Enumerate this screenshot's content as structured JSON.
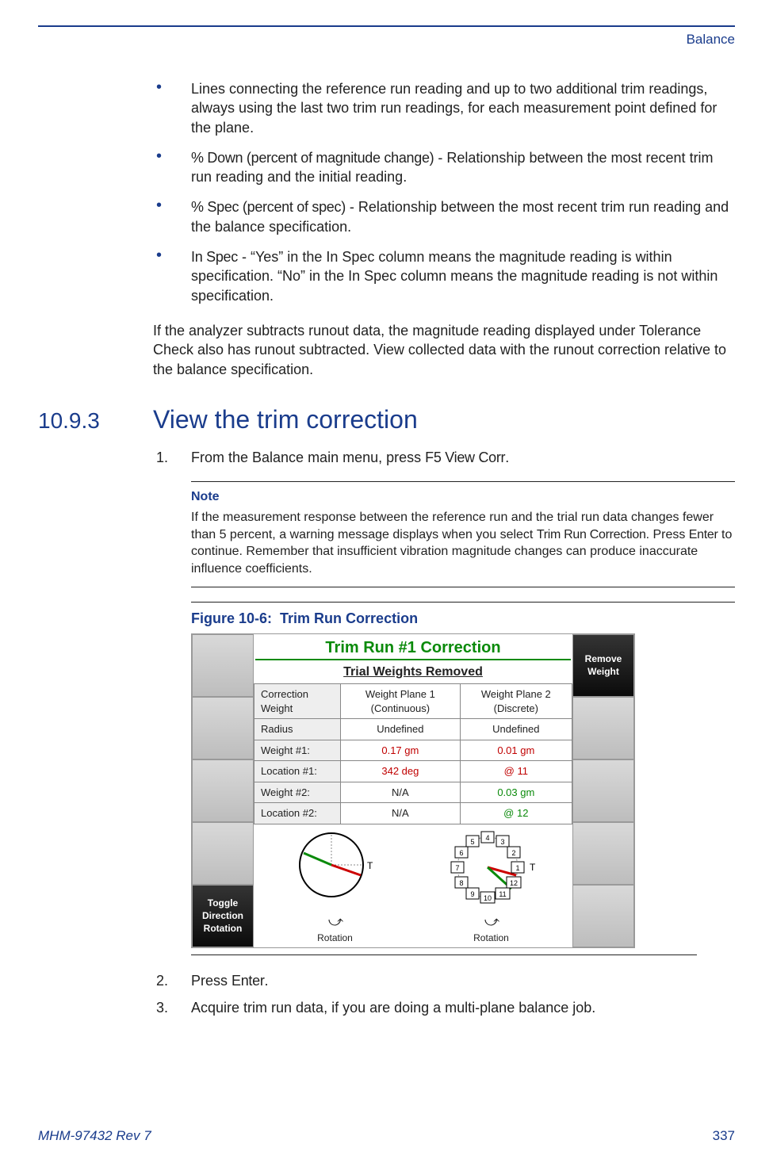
{
  "header": {
    "section": "Balance"
  },
  "bullets": [
    {
      "text": "Lines connecting the reference run reading and up to two additional trim readings, always using the last two trim run readings, for each measurement point defined for the plane."
    },
    {
      "lead": "% Down (percent of magnitude change)",
      "text": " - Relationship between the most recent trim run reading and the initial reading."
    },
    {
      "lead": "% Spec (percent of spec)",
      "text": " - Relationship between the most recent trim run reading and the balance specification."
    },
    {
      "lead": "In Spec",
      "text": " - “Yes” in the In Spec column means the magnitude reading is within specification. “No” in the In Spec column means the magnitude reading is not within specification."
    }
  ],
  "para_after_bullets": "If the analyzer subtracts runout data, the magnitude reading displayed under Tolerance Check also has runout subtracted. View collected data with the runout correction relative to the balance specification.",
  "section": {
    "number": "10.9.3",
    "title": "View the trim correction"
  },
  "steps": {
    "s1": {
      "num": "1.",
      "before": "From the Balance main menu, press ",
      "key": "F5 View Corr",
      "after": "."
    },
    "s2": {
      "num": "2.",
      "before": "Press ",
      "key": "Enter",
      "after": "."
    },
    "s3": {
      "num": "3.",
      "text": "Acquire trim run data, if you are doing a multi-plane balance job."
    }
  },
  "note": {
    "label": "Note",
    "text_before": "If the measurement response between the reference run and the trial run data changes fewer than 5 percent, a warning message displays when you select ",
    "key1": "Trim Run Correction",
    "mid": ". Press ",
    "key2": "Enter",
    "text_after": " to continue. Remember that insufficient vibration magnitude changes can produce inaccurate influence coefficients."
  },
  "figure": {
    "caption_prefix": "Figure 10-6:",
    "caption_title": "Trim Run Correction",
    "device": {
      "title": "Trim Run #1 Correction",
      "subtitle": "Trial Weights Removed",
      "left_buttons": [
        "",
        "",
        "",
        "",
        "Toggle Direction Rotation"
      ],
      "right_buttons": [
        "Remove Weight",
        "",
        "",
        "",
        ""
      ],
      "table": {
        "headers": [
          "Correction Weight",
          "Weight Plane 1 (Continuous)",
          "Weight Plane 2 (Discrete)"
        ],
        "rows": [
          {
            "label": "Radius",
            "c1": "Undefined",
            "c2": "Undefined",
            "c1_color": "",
            "c2_color": ""
          },
          {
            "label": "Weight #1:",
            "c1": "0.17   gm",
            "c2": "0.01   gm",
            "c1_color": "red",
            "c2_color": "red"
          },
          {
            "label": "Location #1:",
            "c1": "342  deg",
            "c2": "@ 11",
            "c1_color": "red",
            "c2_color": "red"
          },
          {
            "label": "Weight #2:",
            "c1": "N/A",
            "c2": "0.03   gm",
            "c1_color": "",
            "c2_color": "green"
          },
          {
            "label": "Location #2:",
            "c1": "N/A",
            "c2": "@ 12",
            "c1_color": "",
            "c2_color": "green"
          }
        ]
      },
      "diagram_labels": {
        "rotation": "Rotation",
        "t": "T"
      },
      "discrete_positions": [
        1,
        2,
        3,
        4,
        5,
        6,
        7,
        8,
        9,
        10,
        11,
        12
      ]
    }
  },
  "footer": {
    "doc": "MHM-97432 Rev 7",
    "page": "337"
  }
}
